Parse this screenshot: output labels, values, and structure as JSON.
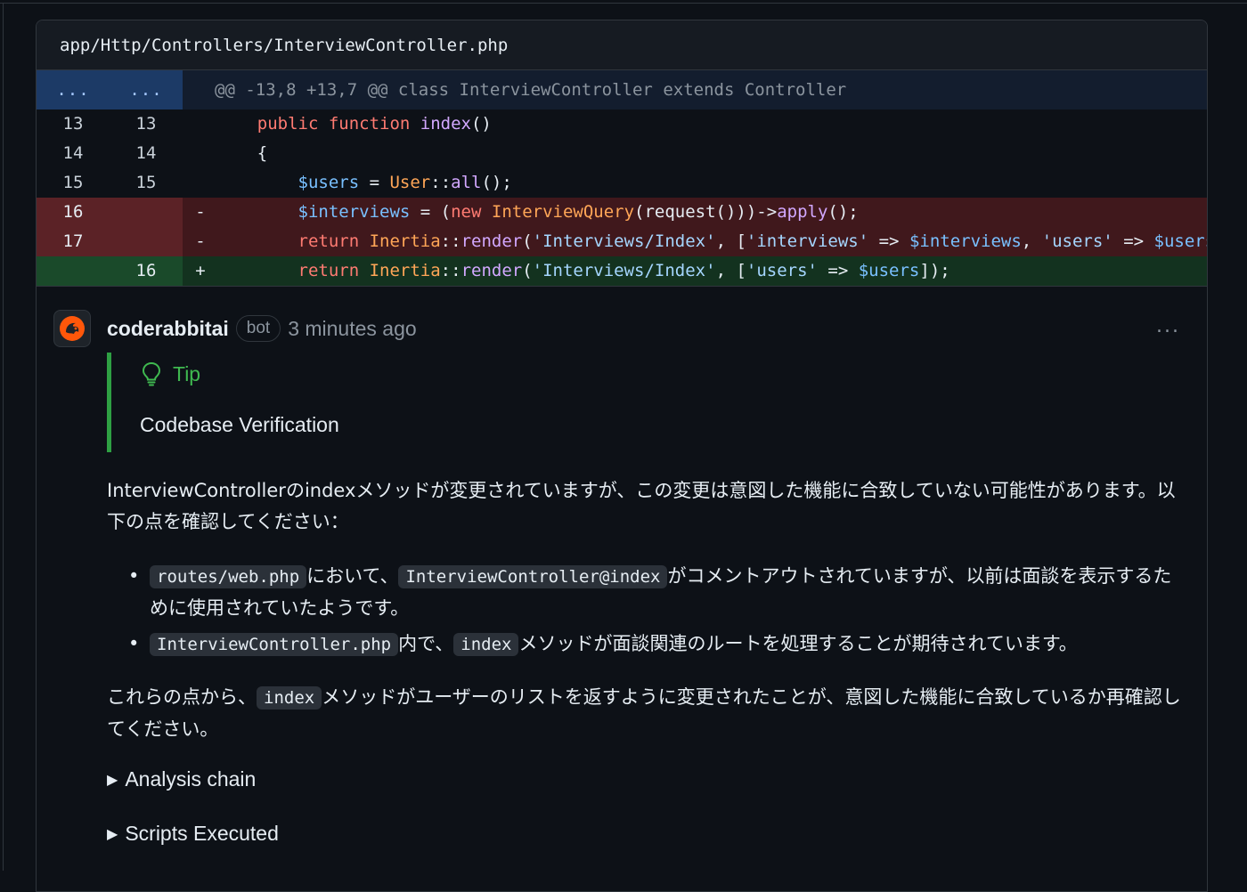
{
  "file": {
    "path": "app/Http/Controllers/InterviewController.php"
  },
  "hunk": {
    "old_marker": "...",
    "new_marker": "...",
    "header": "@@ -13,8 +13,7 @@ class InterviewController extends Controller"
  },
  "rows": [
    {
      "type": "ctx",
      "old": "13",
      "new": "13",
      "sign": ""
    },
    {
      "type": "ctx",
      "old": "14",
      "new": "14",
      "sign": ""
    },
    {
      "type": "ctx",
      "old": "15",
      "new": "15",
      "sign": ""
    },
    {
      "type": "del",
      "old": "16",
      "new": "",
      "sign": "-"
    },
    {
      "type": "del",
      "old": "17",
      "new": "",
      "sign": "-"
    },
    {
      "type": "add",
      "old": "",
      "new": "16",
      "sign": "+"
    }
  ],
  "code": {
    "l1": {
      "a": "    public",
      "b": " function",
      "c": " index",
      "d": "()"
    },
    "l2": {
      "a": "    {"
    },
    "l3": {
      "a": "        $users",
      "b": " = ",
      "c": "User",
      "d": "::",
      "e": "all",
      "f": "();"
    },
    "l4": {
      "a": "        $interviews",
      "b": " = (",
      "c": "new",
      "d": " InterviewQuery",
      "e": "(request()))->",
      "f": "apply",
      "g": "();"
    },
    "l5": {
      "a": "        return",
      "b": " Inertia",
      "c": "::",
      "d": "render",
      "e": "(",
      "f": "'Interviews/Index'",
      "g": ", [",
      "h": "'interviews'",
      "i": " => ",
      "j": "$interviews",
      "k": ", ",
      "l": "'users'",
      "m": " => ",
      "n": "$users]);"
    },
    "l6": {
      "a": "        return",
      "b": " Inertia",
      "c": "::",
      "d": "render",
      "e": "(",
      "f": "'Interviews/Index'",
      "g": ", [",
      "h": "'users'",
      "i": " => ",
      "j": "$users",
      "k": "]);"
    }
  },
  "comment": {
    "author": "coderabbitai",
    "badge": "bot",
    "time": "3 minutes ago",
    "more": "...",
    "tip_label": "Tip",
    "tip_body": "Codebase Verification",
    "p1": "InterviewControllerのindexメソッドが変更されていますが、この変更は意図した機能に合致していない可能性があります。以下の点を確認してください：",
    "li1_code1": "routes/web.php",
    "li1_mid": "において、",
    "li1_code2": "InterviewController@index",
    "li1_end": "がコメントアウトされていますが、以前は面談を表示するために使用されていたようです。",
    "li2_code1": "InterviewController.php",
    "li2_mid": "内で、",
    "li2_code2": "index",
    "li2_end": "メソッドが面談関連のルートを処理することが期待されています。",
    "p2_start": "これらの点から、",
    "p2_code": "index",
    "p2_end": "メソッドがユーザーのリストを返すように変更されたことが、意図した機能に合致しているか再確認してください。",
    "details1": "Analysis chain",
    "details2": "Scripts Executed"
  },
  "colors": {
    "tip": "#3fb950",
    "deleted_row": "#40181c",
    "added_row": "#13321f",
    "hunk_gutter": "#1c3a66"
  }
}
